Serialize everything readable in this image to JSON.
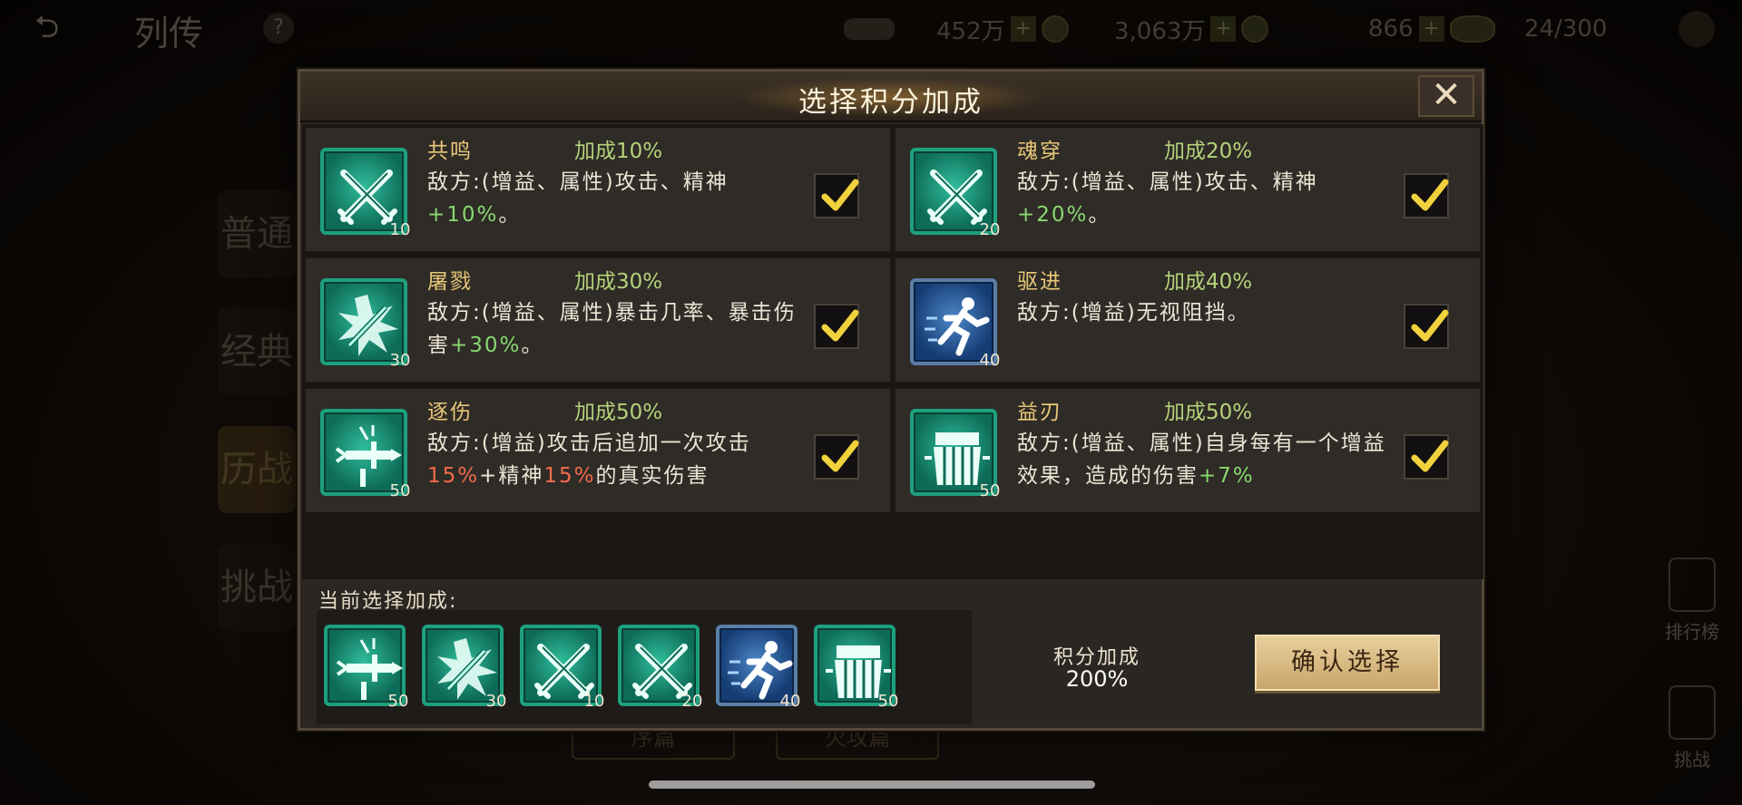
{
  "background": {
    "title": "列传",
    "help": "?",
    "resources": [
      {
        "value": "452万",
        "plus": "+"
      },
      {
        "value": "3,063万",
        "plus": "+"
      },
      {
        "value": "866",
        "plus": "+"
      },
      {
        "value": "24/300",
        "plus": ""
      }
    ],
    "side_tabs": [
      "普通",
      "经典",
      "历战",
      "挑战"
    ],
    "right_links": [
      "排行榜",
      "挑战"
    ],
    "bottom_tabs": [
      "序篇",
      "火攻篇"
    ]
  },
  "modal": {
    "title": "选择积分加成",
    "close": "✕",
    "cards": [
      {
        "name": "共鸣",
        "bonus": "加成10%",
        "level": "10",
        "icon": "crossed-swords-icon",
        "desc_prefix": "敌方:(增益、属性)攻击、精神",
        "hl1": "+10%",
        "desc_suffix": "。"
      },
      {
        "name": "魂穿",
        "bonus": "加成20%",
        "level": "20",
        "icon": "crossed-swords-icon",
        "desc_prefix": "敌方:(增益、属性)攻击、精神",
        "hl1": "+20%",
        "desc_suffix": "。"
      },
      {
        "name": "屠戮",
        "bonus": "加成30%",
        "level": "30",
        "icon": "burst-blade-icon",
        "desc_prefix": "敌方:(增益、属性)暴击几率、暴击伤害",
        "hl1": "+30%",
        "desc_suffix": "。"
      },
      {
        "name": "驱进",
        "bonus": "加成40%",
        "level": "40",
        "icon": "running-man-icon",
        "desc_prefix": "敌方:(增益)无视阻挡。",
        "hl1": "",
        "desc_suffix": ""
      },
      {
        "name": "逐伤",
        "bonus": "加成50%",
        "level": "50",
        "icon": "dagger-icon",
        "desc_prefix": "敌方:(增益)攻击后追加一次攻击",
        "hl1": "15%",
        "mid": "+精神",
        "hl2": "15%",
        "desc_suffix": "的真实伤害"
      },
      {
        "name": "益刃",
        "bonus": "加成50%",
        "level": "50",
        "icon": "armor-icon",
        "desc_prefix": "敌方:(增益、属性)自身每有一个增益效果，造成的伤害",
        "hl1": "+7%",
        "desc_suffix": ""
      }
    ],
    "current_label": "当前选择加成:",
    "selected": [
      {
        "icon": "dagger-icon",
        "level": "50"
      },
      {
        "icon": "burst-blade-icon",
        "level": "30"
      },
      {
        "icon": "crossed-swords-icon",
        "level": "10"
      },
      {
        "icon": "crossed-swords-icon",
        "level": "20"
      },
      {
        "icon": "running-man-icon",
        "level": "40"
      },
      {
        "icon": "armor-icon",
        "level": "50"
      }
    ],
    "score_label": "积分加成",
    "score_value": "200%",
    "confirm": "确认选择"
  },
  "colors": {
    "teal": "#1da07e",
    "blue": "#5b7ea7",
    "gold": "#e8c878",
    "green": "#88d86f",
    "red": "#f26b4a"
  }
}
